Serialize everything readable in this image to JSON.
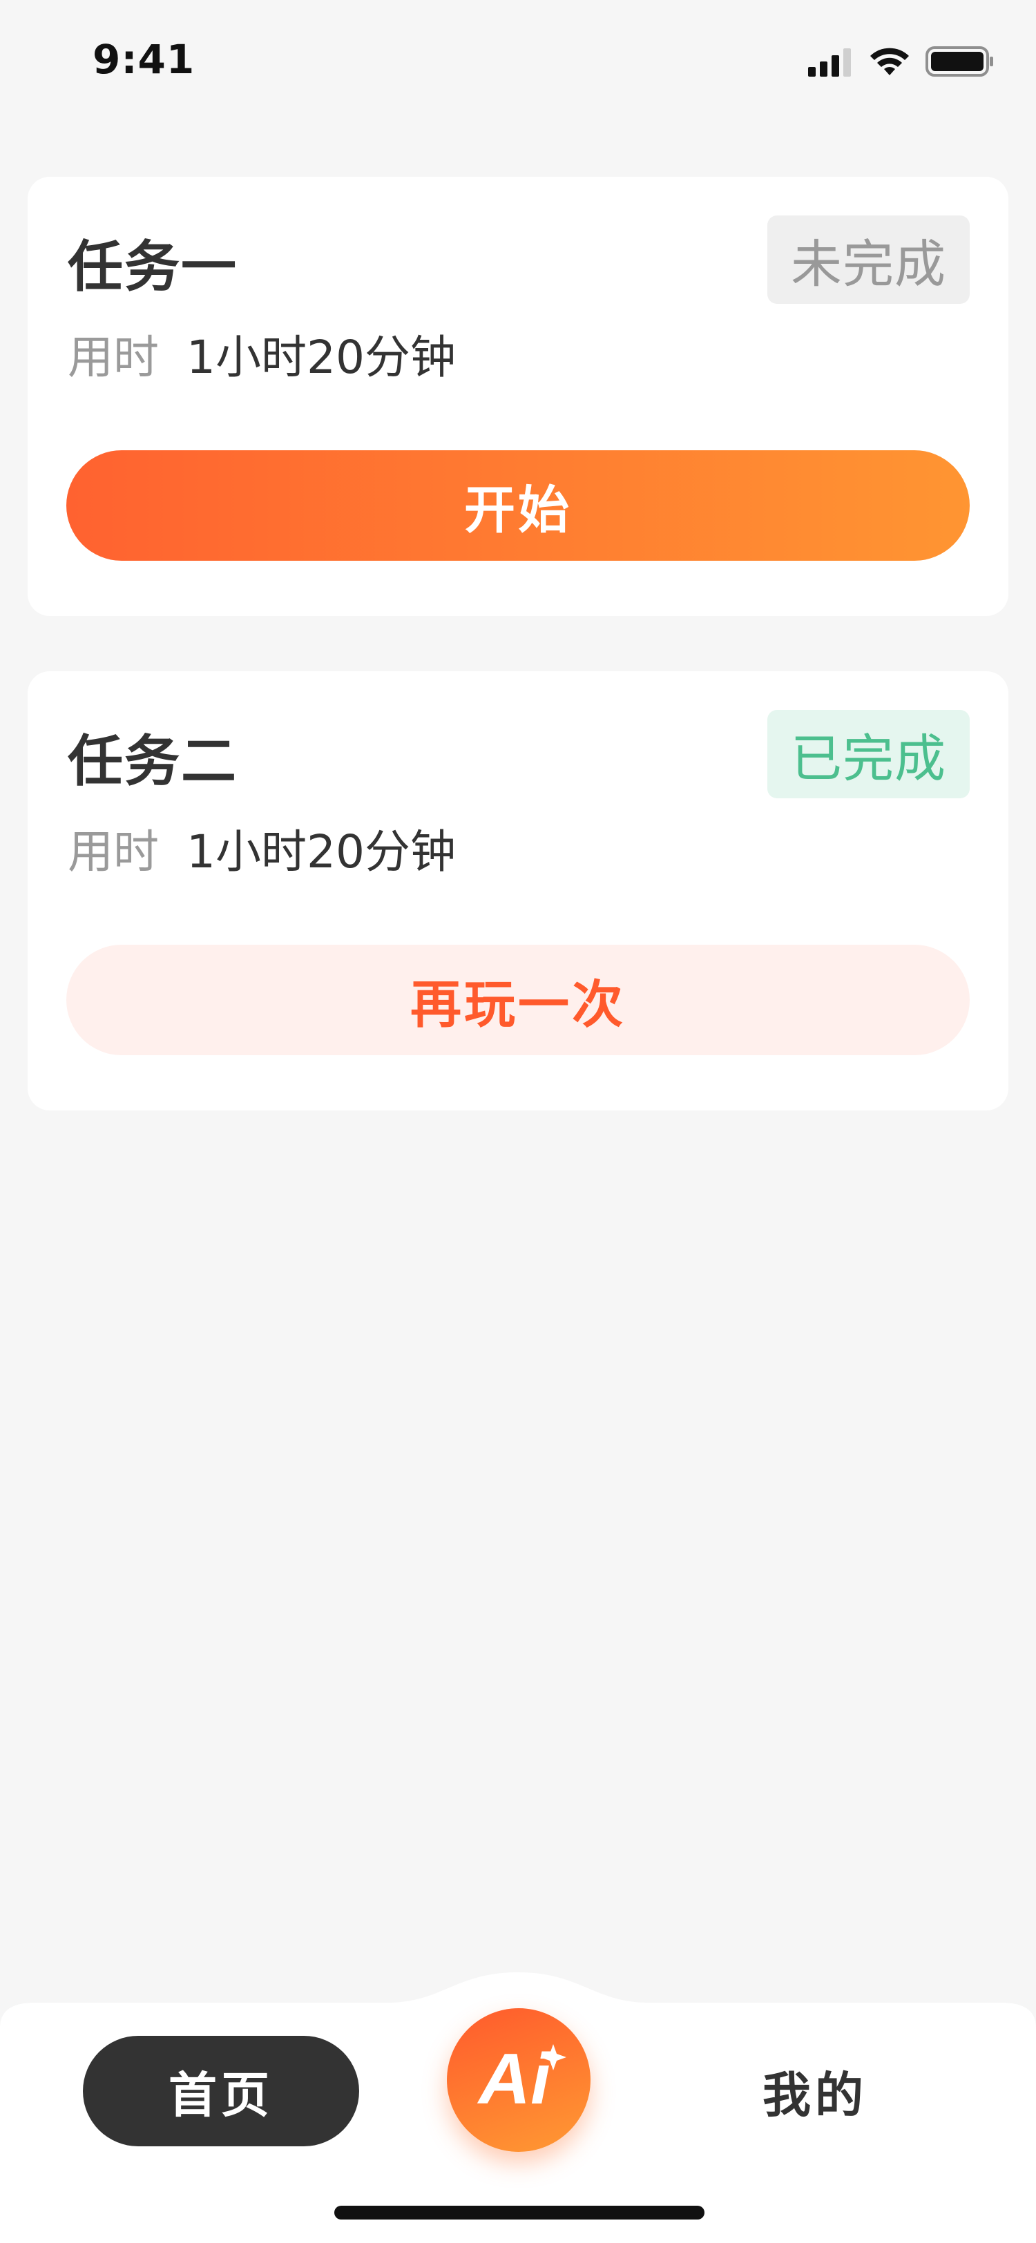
{
  "status_bar": {
    "time": "9:41"
  },
  "tasks": [
    {
      "title": "任务一",
      "status": "未完成",
      "duration_label": "用时",
      "duration_value": "1小时20分钟",
      "action_label": "开始"
    },
    {
      "title": "任务二",
      "status": "已完成",
      "duration_label": "用时",
      "duration_value": "1小时20分钟",
      "action_label": "再玩一次"
    }
  ],
  "tabbar": {
    "home_label": "首页",
    "ai_label": "Ai",
    "mine_label": "我的"
  },
  "colors": {
    "accent_start": "#ff6230",
    "accent_end": "#ff9532",
    "complete_green": "#4cbf8e",
    "incomplete_gray": "#999999"
  }
}
